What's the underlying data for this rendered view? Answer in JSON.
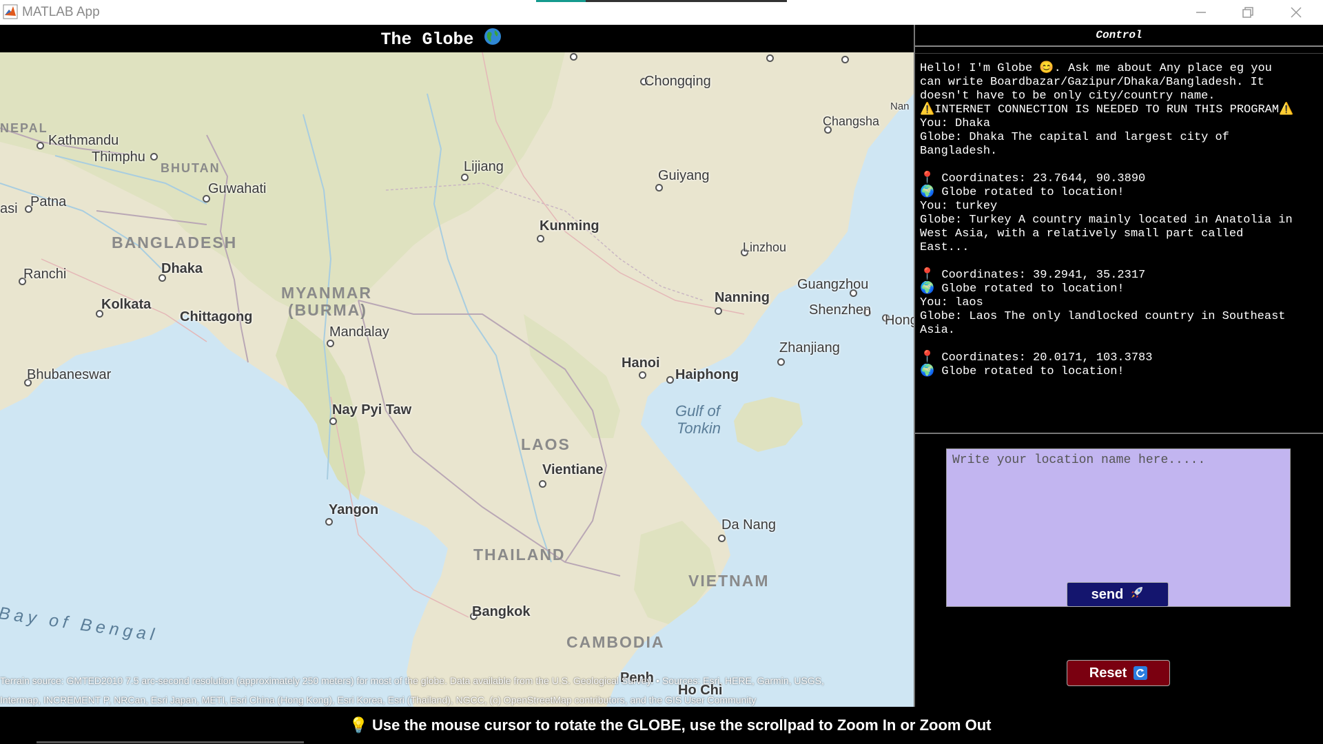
{
  "window": {
    "title": "MATLAB App",
    "minimize_icon": "minimize-icon",
    "restore_icon": "restore-icon",
    "close_icon": "close-icon"
  },
  "map_panel": {
    "title": "The Globe",
    "title_icon": "globe-icon",
    "attribution_line1": "Terrain source: GMTED2010 7.5 arc-second resolution (approximately 250 meters) for most of the globe. Data available from the U.S. Geological Survey. • Sources: Esri, HERE, Garmin, USGS,",
    "attribution_line2": "Intermap, INCREMENT P, NRCan, Esri Japan, METI, Esri China (Hong Kong), Esri Korea, Esri (Thailand), NGCC, (c) OpenStreetMap contributors, and the GIS User Community",
    "labels": {
      "chongqing": "Chongqing",
      "changsha": "Changsha",
      "nan": "Nan",
      "nepal": "NEPAL",
      "kathmandu": "Kathmandu",
      "thimphu": "Thimphu",
      "bhutan": "BHUTAN",
      "guwahati": "Guwahati",
      "lijiang": "Lijiang",
      "guiyang": "Guiyang",
      "patna": "Patna",
      "asi": "asi",
      "kunming": "Kunming",
      "bangladesh": "BANGLADESH",
      "linzhou": "Linzhou",
      "ranchi": "Ranchi",
      "dhaka": "Dhaka",
      "myanmar": "MYANMAR",
      "burma": "(BURMA)",
      "guangzhou": "Guangzhou",
      "kolkata": "Kolkata",
      "chittagong": "Chittagong",
      "nanning": "Nanning",
      "shenzhen": "Shenzhen",
      "hong": "Hong",
      "mandalay": "Mandalay",
      "zhanjiang": "Zhanjiang",
      "hanoi": "Hanoi",
      "bhubaneswar": "Bhubaneswar",
      "haiphong": "Haiphong",
      "gulf1": "Gulf of",
      "gulf2": "Tonkin",
      "naypyitaw": "Nay Pyi Taw",
      "laos": "LAOS",
      "vientiane": "Vientiane",
      "yangon": "Yangon",
      "danang": "Da Nang",
      "thailand": "THAILAND",
      "vietnam": "VIETNAM",
      "bay": "Bay of Bengal",
      "bangkok": "Bangkok",
      "cambodia": "CAMBODIA",
      "hochi": "Ho Chi",
      "penh": "Penh"
    }
  },
  "control_panel": {
    "title": "Control",
    "chat_lines": "Hello! I'm Globe 😊. Ask me about Any place eg you\ncan write Boardbazar/Gazipur/Dhaka/Bangladesh. It\ndoesn't have to be only city/country name.\n⚠️INTERNET CONNECTION IS NEEDED TO RUN THIS PROGRAM⚠️\nYou: Dhaka\nGlobe: Dhaka The capital and largest city of\nBangladesh.\n\n📍 Coordinates: 23.7644, 90.3890\n🌍 Globe rotated to location!\nYou: turkey\nGlobe: Turkey A country mainly located in Anatolia in\nWest Asia, with a relatively small part called\nEast...\n\n📍 Coordinates: 39.2941, 35.2317\n🌍 Globe rotated to location!\nYou: laos\nGlobe: Laos The only landlocked country in Southeast\nAsia.\n\n📍 Coordinates: 20.0171, 103.3783\n🌍 Globe rotated to location!",
    "input_placeholder": "Write your location name here.....",
    "input_value": "",
    "send_label": "send",
    "send_icon": "rocket-icon",
    "reset_label": "Reset",
    "reset_icon": "refresh-icon"
  },
  "footer": {
    "hint_icon": "lightbulb-icon",
    "hint": "💡 Use the mouse cursor to rotate the GLOBE, use the scrollpad to Zoom In or Zoom Out"
  },
  "colors": {
    "land": "#e9e5cf",
    "water": "#cfe6f3",
    "input_bg": "#c2b5f0",
    "send_bg": "#14156e",
    "reset_bg": "#7a0010"
  }
}
